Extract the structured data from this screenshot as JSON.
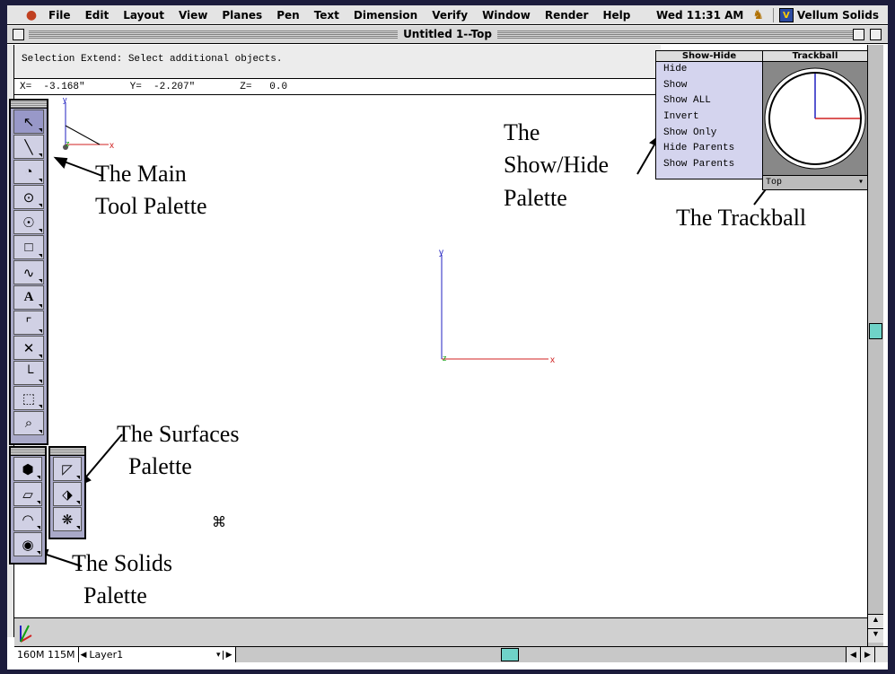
{
  "menubar": {
    "apple_icon": "apple-logo",
    "items": [
      "File",
      "Edit",
      "Layout",
      "View",
      "Planes",
      "Pen",
      "Text",
      "Dimension",
      "Verify",
      "Window",
      "Render",
      "Help"
    ],
    "clock": "Wed 11:31 AM",
    "app_name": "Vellum Solids"
  },
  "window": {
    "title": "Untitled 1--Top"
  },
  "prompt": {
    "text": "Selection Extend: Select additional objects."
  },
  "coords": {
    "x": "X=  -3.168\"",
    "y": "Y=  -2.207\"",
    "z": "Z=   0.0"
  },
  "canvas_axes": {
    "small_origin": {
      "x_label": "x",
      "y_label": "y",
      "z_label": "z"
    },
    "center_origin": {
      "x_label": "x",
      "y_label": "y",
      "z_label": "z"
    }
  },
  "show_hide": {
    "title": "Show-Hide",
    "items": [
      "Hide",
      "Show",
      "Show ALL",
      "Invert",
      "Show Only",
      "Hide Parents",
      "Show Parents"
    ]
  },
  "trackball": {
    "title": "Trackball",
    "view": "Top"
  },
  "status": {
    "mem1": "160M",
    "mem2": "115M",
    "layer": "Layer1"
  },
  "main_tools": [
    "arrow-icon",
    "line-icon",
    "arc-icon",
    "circle-icon",
    "ellipse-icon",
    "rectangle-icon",
    "curve-icon",
    "text-icon",
    "fillet-icon",
    "trim-icon",
    "dimension-icon",
    "point-icon",
    "zoom-icon"
  ],
  "annotations": {
    "main_tool": "The Main\nTool Palette",
    "show_hide": "The\nShow/Hide\nPalette",
    "trackball": "The Trackball",
    "surfaces": "The Surfaces\n  Palette",
    "solids": "The Solids\n  Palette"
  },
  "cmd_glyph": "⌘"
}
